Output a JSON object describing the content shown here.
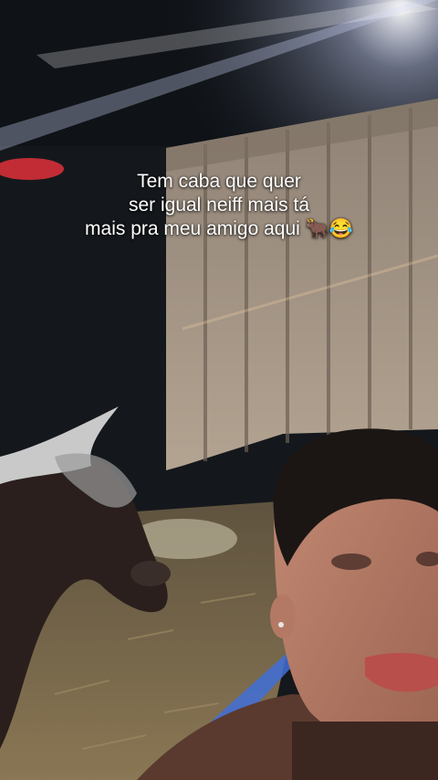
{
  "caption": {
    "lines": [
      "Tem caba que quer",
      "ser igual neiff mais tá",
      "mais pra meu amigo aqui 🐂😂"
    ]
  },
  "scene": {
    "subjects": [
      "goat",
      "person-selfie",
      "wooden-fence",
      "hay-floor",
      "stage-light"
    ]
  },
  "colors": {
    "wall": "#14181c",
    "fence": "#9a8a78",
    "hay": "#7a6a4e",
    "caption_text": "#ffffff"
  }
}
